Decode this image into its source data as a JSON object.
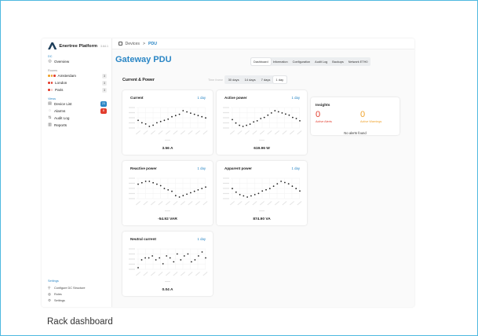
{
  "colors": {
    "accent": "#2a86c5",
    "alert": "#e23d2d",
    "warning": "#f0a22a",
    "frame": "#4fb8e0"
  },
  "app": {
    "name": "Enertree Platform",
    "version": "3.64.1",
    "logo_icon": "mountain-logo-icon"
  },
  "sidebar": {
    "dc_label": "DC",
    "overview": {
      "label": "Overview",
      "icon": "globe-icon"
    },
    "rooms_label": "Rooms",
    "rooms": [
      {
        "label": "Amsterdam",
        "count": "3",
        "dots": [
          "#f0a22a",
          "#f0a22a",
          "#e23d2d"
        ]
      },
      {
        "label": "London",
        "count": "3",
        "dots": [
          "#e23d2d",
          "#e23d2d"
        ]
      },
      {
        "label": "Paris",
        "count": "3",
        "dots": [
          "#e23d2d",
          "#f6c6c2"
        ]
      }
    ],
    "views_label": "Views",
    "views": [
      {
        "label": "Device List",
        "icon": "list-icon",
        "badge": "23",
        "badge_color": "#2a86c5"
      },
      {
        "label": "Alarms",
        "icon": "bell-icon",
        "badge": "8",
        "badge_color": "#e23d2d"
      },
      {
        "label": "Audit Log",
        "icon": "log-icon"
      },
      {
        "label": "Reports",
        "icon": "report-icon"
      }
    ],
    "settings_label": "Settings",
    "settings": [
      {
        "label": "Configure DC Structure",
        "icon": "structure-icon"
      },
      {
        "label": "Roles",
        "icon": "roles-icon"
      },
      {
        "label": "Settings",
        "icon": "gear-icon"
      }
    ]
  },
  "breadcrumb": {
    "root": "Devices",
    "separator": ">",
    "current": "PDU"
  },
  "page": {
    "title": "Gateway PDU"
  },
  "tabs": [
    "Dashboard",
    "Information",
    "Configuration",
    "Audit Log",
    "Backups",
    "Network ETH0"
  ],
  "active_tab": 0,
  "section": {
    "title": "Current & Power"
  },
  "time_filter": {
    "label": "Time frame",
    "options": [
      "30 days",
      "14 days",
      "7 days",
      "1 day"
    ],
    "active": 3
  },
  "charts": [
    {
      "title": "Current",
      "range": "1 day",
      "value": "3.56 A",
      "y": [
        3.1,
        2.9,
        2.8,
        2.6,
        2.7,
        2.9,
        3.0,
        3.1,
        3.2,
        3.4,
        3.5,
        3.6,
        3.9,
        3.8,
        3.7,
        3.6,
        3.5,
        3.4,
        3.3
      ]
    },
    {
      "title": "Active power",
      "range": "1 day",
      "value": "619.96 W",
      "y": [
        4,
        3.7,
        3.5,
        3.4,
        3.5,
        3.6,
        3.8,
        3.9,
        4.1,
        4.2,
        4.4,
        4.6,
        4.8,
        4.7,
        4.6,
        4.5,
        4.4,
        4.2,
        4.1,
        3.9
      ]
    },
    {
      "title": "Reactive power",
      "range": "1 day",
      "value": "-54.92 VAR",
      "y": [
        4.1,
        4.2,
        4.3,
        4.3,
        4.2,
        4.1,
        4.0,
        3.8,
        3.7,
        3.6,
        3.3,
        3.2,
        3.3,
        3.4,
        3.5,
        3.6,
        3.7,
        3.8,
        3.9
      ]
    },
    {
      "title": "Apparent power",
      "range": "1 day",
      "value": "874.90 VA",
      "y": [
        4.0,
        3.7,
        3.5,
        3.4,
        3.3,
        3.4,
        3.5,
        3.6,
        3.8,
        3.9,
        4.0,
        4.2,
        4.4,
        4.6,
        4.5,
        4.4,
        4.2,
        4.0,
        3.8
      ]
    },
    {
      "title": "Neutral current",
      "range": "1 day",
      "value": "0.04 A",
      "y": [
        3.2,
        3.6,
        3.7,
        3.7,
        3.8,
        3.6,
        3.7,
        3.4,
        3.8,
        3.7,
        3.5,
        3.9,
        3.6,
        3.8,
        3.9,
        3.5,
        3.6,
        3.8,
        4.0,
        3.7
      ]
    }
  ],
  "insights": {
    "title": "Insights",
    "alerts": {
      "value": "0",
      "label": "Active Alerts"
    },
    "warnings": {
      "value": "0",
      "label": "Active Warnings"
    },
    "message": "No alerts found"
  },
  "caption": "Rack dashboard"
}
